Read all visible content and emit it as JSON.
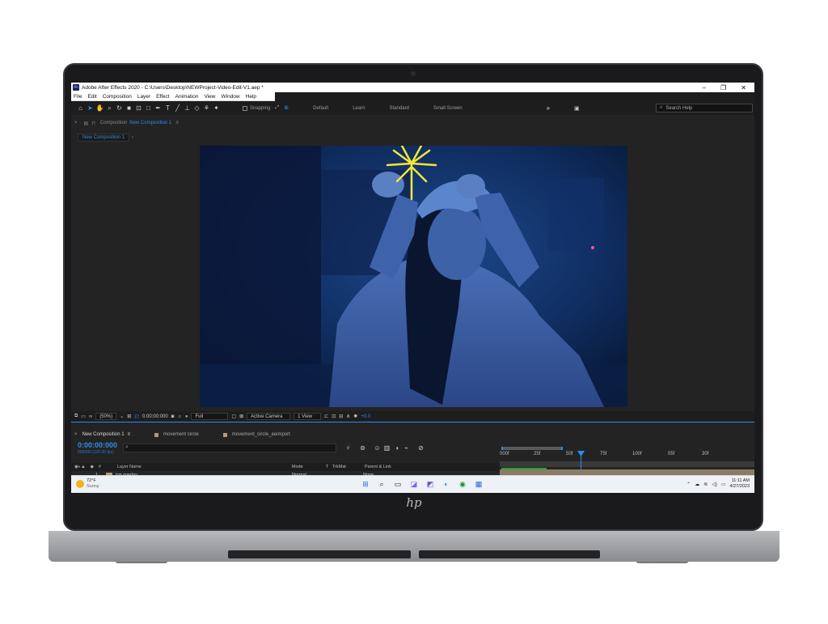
{
  "window": {
    "title": "Adobe After Effects 2020 - C:\\Users\\Desktop\\NEWProject-Video-Edit-V1.aep *",
    "app_icon": "Ae"
  },
  "menu": [
    "File",
    "Edit",
    "Composition",
    "Layer",
    "Effect",
    "Animation",
    "View",
    "Window",
    "Help"
  ],
  "toolbar": {
    "snapping_label": "Snapping",
    "workspaces": [
      "Default",
      "Learn",
      "Standard",
      "Small Screen"
    ],
    "search_placeholder": "Search Help"
  },
  "composition_panel": {
    "label": "Composition",
    "name": "New Composition 1",
    "tab": "New Composition 1"
  },
  "viewer_controls": {
    "zoom": "(50%)",
    "timecode": "0:00:00:000",
    "resolution": "Full",
    "camera": "Active Camera",
    "views": "1 View",
    "exposure": "+0.0"
  },
  "timeline": {
    "tabs": [
      "New Composition 1",
      "movement circle",
      "movement_circle_aeimport"
    ],
    "timecode": "0:00:00:000",
    "fps": "000000 (120.00 fps)",
    "ruler": [
      "000f",
      "25f",
      "50f",
      "75f",
      "100f",
      "05f",
      "30f"
    ],
    "columns": [
      "Layer Name",
      "Mode",
      "T",
      "TrkMat",
      "Parent & Link"
    ],
    "layer": {
      "number": "1",
      "name": "top overlay",
      "mode": "Normal",
      "parent": "None"
    }
  },
  "taskbar": {
    "temperature": "72°F",
    "condition": "Sunny",
    "time": "11:11 AM",
    "date": "4/27/2023"
  },
  "colors": {
    "accent": "#2d8ceb",
    "panel": "#232323",
    "label_swatch": "#b29a76"
  }
}
